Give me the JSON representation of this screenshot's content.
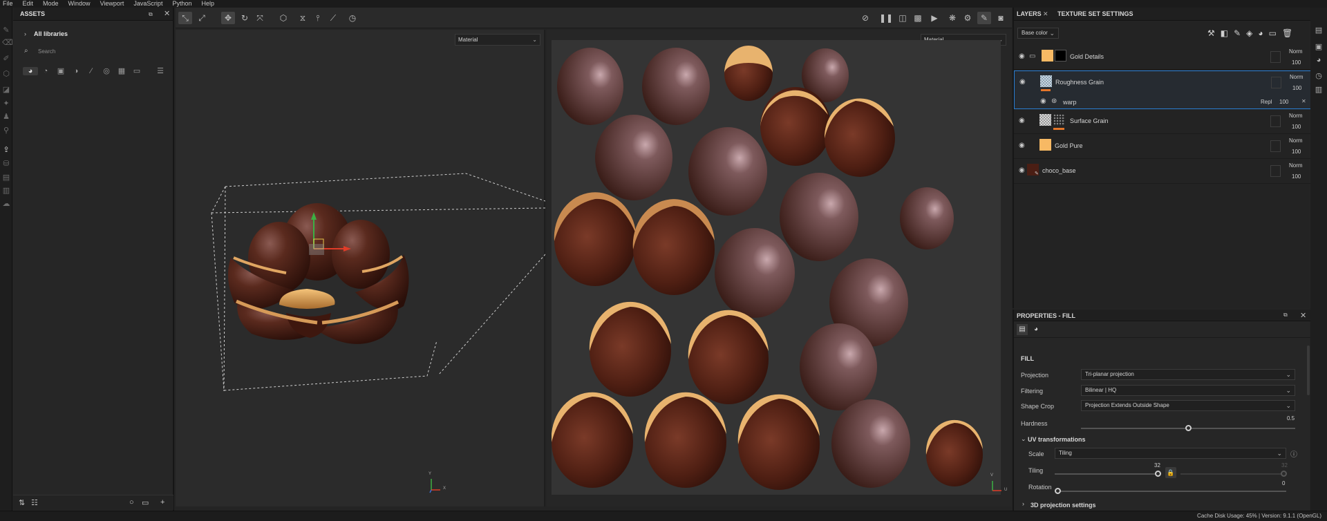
{
  "menu": [
    "File",
    "Edit",
    "Mode",
    "Window",
    "Viewport",
    "JavaScript",
    "Python",
    "Help"
  ],
  "assets": {
    "title": "ASSETS",
    "library_label": "All libraries",
    "search_placeholder": "Search"
  },
  "viewport3d": {
    "material_mode": "Material",
    "gizmo_axes": [
      "Y",
      "X"
    ]
  },
  "viewport2d": {
    "material_mode": "Material",
    "gizmo_axes": [
      "V",
      "U"
    ]
  },
  "layers_panel": {
    "tab_layers": "LAYERS",
    "tab_texture_set": "TEXTURE SET SETTINGS",
    "channel": "Base color",
    "layers": [
      {
        "name": "Gold Details",
        "blend": "Norm",
        "opacity": "100"
      },
      {
        "name": "Roughness Grain",
        "blend": "Norm",
        "opacity": "100"
      },
      {
        "name": "Surface Grain",
        "blend": "Norm",
        "opacity": "100"
      },
      {
        "name": "Gold Pure",
        "blend": "Norm",
        "opacity": "100"
      },
      {
        "name": "choco_base",
        "blend": "Norm",
        "opacity": "100"
      }
    ],
    "effect": {
      "name": "warp",
      "blend": "Repl",
      "opacity": "100"
    }
  },
  "properties": {
    "title": "PROPERTIES - FILL",
    "section": "FILL",
    "projection_label": "Projection",
    "projection_value": "Tri-planar projection",
    "filtering_label": "Filtering",
    "filtering_value": "Bilinear | HQ",
    "shape_crop_label": "Shape Crop",
    "shape_crop_value": "Projection Extends Outside Shape",
    "hardness_label": "Hardness",
    "hardness_value": "0.5",
    "hardness_level": 0.5,
    "uv_section": "UV transformations",
    "scale_label": "Scale",
    "scale_value": "Tiling",
    "tiling_label": "Tiling",
    "tiling_value": "32",
    "tiling_value_2": "32",
    "rotation_label": "Rotation",
    "rotation_value": "0",
    "projection3d_section": "3D projection settings"
  },
  "status": {
    "text": "Cache Disk Usage:   45% | Version: 9.1.1 (OpenGL)"
  },
  "colors": {
    "accent": "#2a7fd4",
    "gold": "#f7b964",
    "chocolate": "#4a1e14",
    "orange_bar": "#e4762a"
  }
}
